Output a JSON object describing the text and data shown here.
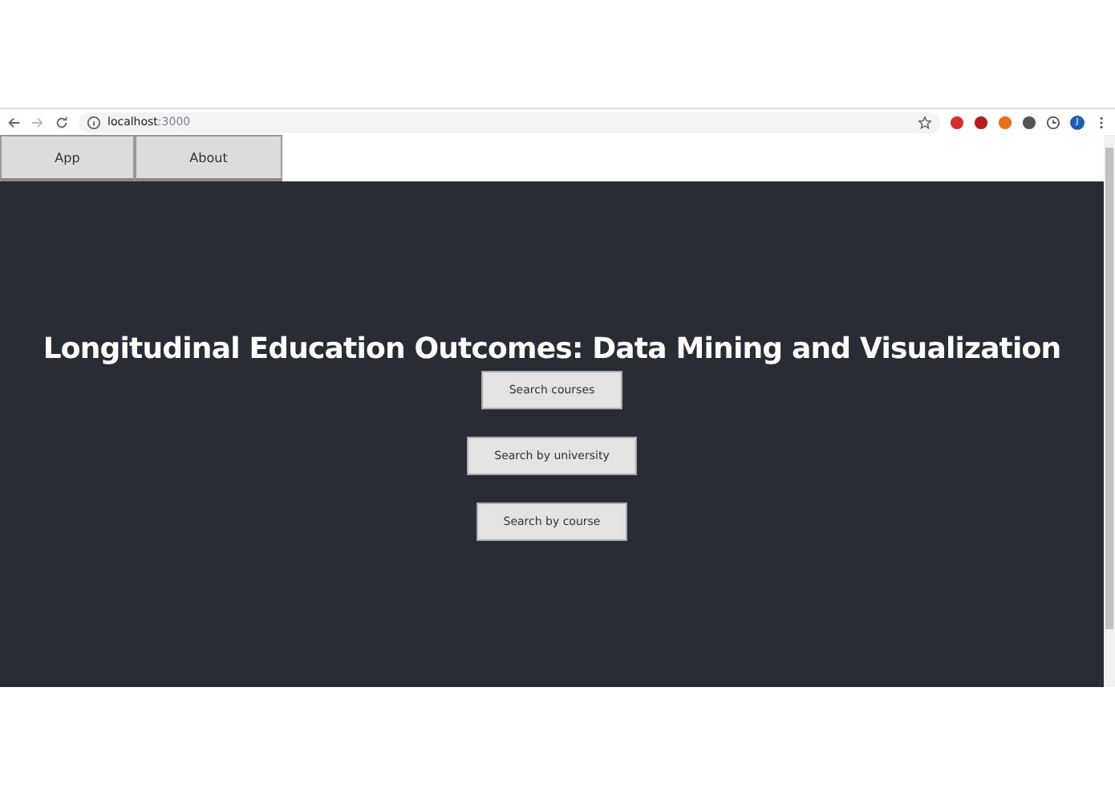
{
  "browser": {
    "url_host": "localhost",
    "url_port": ":3000",
    "profile_initial": "J"
  },
  "nav": {
    "tabs": [
      {
        "label": "App",
        "selected": false
      },
      {
        "label": "About",
        "selected": false
      }
    ]
  },
  "hero": {
    "title": "Longitudinal Education Outcomes: Data Mining and Visualization",
    "buttons": [
      "Search courses",
      "Search by university",
      "Search by course"
    ]
  }
}
